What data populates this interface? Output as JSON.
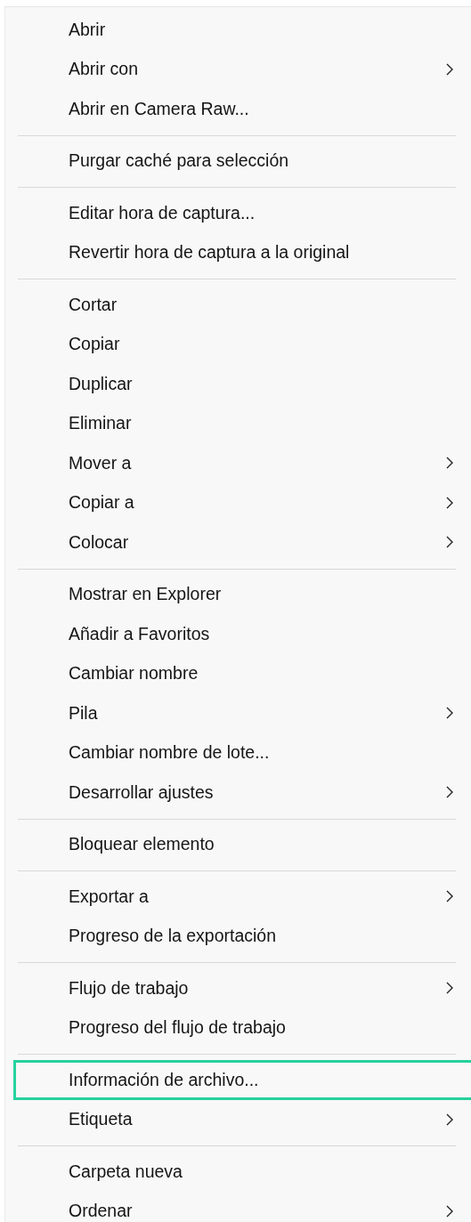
{
  "context_menu": {
    "sections": [
      {
        "items": [
          {
            "label": "Abrir",
            "submenu": false,
            "selected": false
          },
          {
            "label": "Abrir con",
            "submenu": true,
            "selected": false
          },
          {
            "label": "Abrir en Camera Raw...",
            "submenu": false,
            "selected": false
          }
        ]
      },
      {
        "items": [
          {
            "label": "Purgar caché para selección",
            "submenu": false,
            "selected": false
          }
        ]
      },
      {
        "items": [
          {
            "label": "Editar hora de captura...",
            "submenu": false,
            "selected": false
          },
          {
            "label": "Revertir hora de captura a la original",
            "submenu": false,
            "selected": false
          }
        ]
      },
      {
        "items": [
          {
            "label": "Cortar",
            "submenu": false,
            "selected": false
          },
          {
            "label": "Copiar",
            "submenu": false,
            "selected": false
          },
          {
            "label": "Duplicar",
            "submenu": false,
            "selected": false
          },
          {
            "label": "Eliminar",
            "submenu": false,
            "selected": false
          },
          {
            "label": "Mover a",
            "submenu": true,
            "selected": false
          },
          {
            "label": "Copiar a",
            "submenu": true,
            "selected": false
          },
          {
            "label": "Colocar",
            "submenu": true,
            "selected": false
          }
        ]
      },
      {
        "items": [
          {
            "label": "Mostrar en Explorer",
            "submenu": false,
            "selected": false
          },
          {
            "label": "Añadir a Favoritos",
            "submenu": false,
            "selected": false
          },
          {
            "label": "Cambiar nombre",
            "submenu": false,
            "selected": false
          },
          {
            "label": "Pila",
            "submenu": true,
            "selected": false
          },
          {
            "label": "Cambiar nombre de lote...",
            "submenu": false,
            "selected": false
          },
          {
            "label": "Desarrollar ajustes",
            "submenu": true,
            "selected": false
          }
        ]
      },
      {
        "items": [
          {
            "label": "Bloquear elemento",
            "submenu": false,
            "selected": false
          }
        ]
      },
      {
        "items": [
          {
            "label": "Exportar a",
            "submenu": true,
            "selected": false
          },
          {
            "label": "Progreso de la exportación",
            "submenu": false,
            "selected": false
          }
        ]
      },
      {
        "items": [
          {
            "label": "Flujo de trabajo",
            "submenu": true,
            "selected": false
          },
          {
            "label": "Progreso del flujo de trabajo",
            "submenu": false,
            "selected": false
          }
        ]
      },
      {
        "items": [
          {
            "label": "Información de archivo...",
            "submenu": false,
            "selected": true
          },
          {
            "label": "Etiqueta",
            "submenu": true,
            "selected": false
          }
        ]
      },
      {
        "items": [
          {
            "label": "Carpeta nueva",
            "submenu": false,
            "selected": false
          },
          {
            "label": "Ordenar",
            "submenu": true,
            "selected": false
          }
        ]
      }
    ]
  }
}
